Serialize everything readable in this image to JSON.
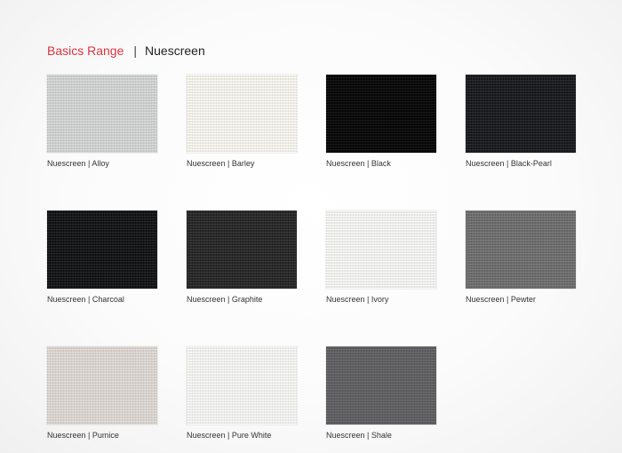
{
  "header": {
    "range": "Basics Range",
    "separator": "|",
    "product": "Nuescreen"
  },
  "swatches": [
    {
      "label": "Nuescreen | Alloy",
      "color": "#cbcccc"
    },
    {
      "label": "Nuescreen | Barley",
      "color": "#ecebe6"
    },
    {
      "label": "Nuescreen | Black",
      "color": "#0b0b0c"
    },
    {
      "label": "Nuescreen | Black-Pearl",
      "color": "#1c1e21"
    },
    {
      "label": "Nuescreen | Charcoal",
      "color": "#17181a"
    },
    {
      "label": "Nuescreen | Graphite",
      "color": "#2a2a2b"
    },
    {
      "label": "Nuescreen | Ivory",
      "color": "#ebebea"
    },
    {
      "label": "Nuescreen | Pewter",
      "color": "#6d6d6d"
    },
    {
      "label": "Nuescreen | Pumice",
      "color": "#d5d0cb"
    },
    {
      "label": "Nuescreen | Pure White",
      "color": "#ececeb"
    },
    {
      "label": "Nuescreen | Shale",
      "color": "#5f5f61"
    }
  ]
}
